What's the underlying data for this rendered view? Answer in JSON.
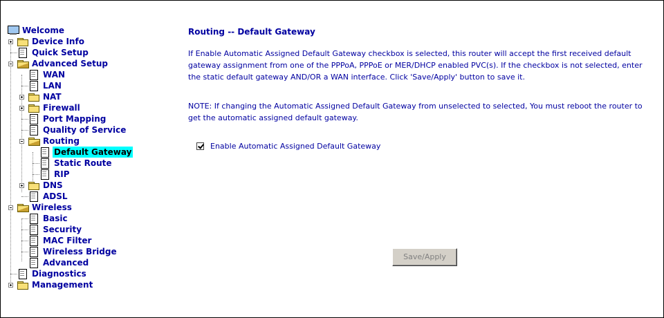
{
  "tree": {
    "welcome": "Welcome",
    "device_info": "Device Info",
    "quick_setup": "Quick Setup",
    "advanced_setup": "Advanced Setup",
    "wan": "WAN",
    "lan": "LAN",
    "nat": "NAT",
    "firewall": "Firewall",
    "port_mapping": "Port Mapping",
    "qos": "Quality of Service",
    "routing": "Routing",
    "default_gateway": "Default Gateway",
    "static_route": "Static Route",
    "rip": "RIP",
    "dns": "DNS",
    "adsl": "ADSL",
    "wireless": "Wireless",
    "basic": "Basic",
    "security": "Security",
    "mac_filter": "MAC Filter",
    "wireless_bridge": "Wireless Bridge",
    "advanced": "Advanced",
    "diagnostics": "Diagnostics",
    "management": "Management"
  },
  "page": {
    "title": "Routing -- Default Gateway",
    "description": "If Enable Automatic Assigned Default Gateway checkbox is selected, this router will accept the first received default gateway assignment from one of the PPPoA, PPPoE or MER/DHCP enabled PVC(s). If the checkbox is not selected, enter the static default gateway AND/OR a WAN interface. Click 'Save/Apply' button to save it.",
    "note": "NOTE: If changing the Automatic Assigned Default Gateway from unselected to selected, You must reboot the router to get the automatic assigned default gateway.",
    "checkbox_label": "Enable Automatic Assigned Default Gateway",
    "checkbox_checked": true,
    "save_button": "Save/Apply"
  },
  "colors": {
    "text": "#0000a0",
    "selection": "#00ffff"
  }
}
